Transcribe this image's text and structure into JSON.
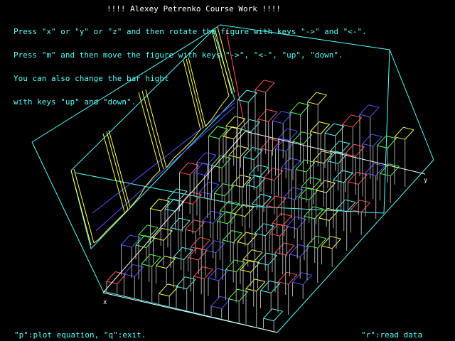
{
  "window": {
    "title": "!!!! Alexey Petrenko Course Work !!!!"
  },
  "instructions": [
    "Press \"x\" or \"y\" or \"z\" and then rotate the figure with keys \"->\" and \"<-\".",
    "Press \"m\" and then move the figure with keys \"->\", \"<-\", \"up\", \"down\".",
    "You can also change the bar hight",
    "with keys \"up\" and \"down\"."
  ],
  "footer": {
    "left": "\"p\":plot equation, \"q\":exit.",
    "right": "\"r\":read data"
  },
  "axes": {
    "x_label": "x",
    "y_label": "y"
  },
  "colors": {
    "background": "#000000",
    "text_title": "#ffffff",
    "text_info": "#55ffff",
    "box_edges": "#55ffff",
    "equation_plot": "#ffff55",
    "plane_line": "#5555ff",
    "bar_edges": "#aaaaaa",
    "bar_top_red": "#ff5555",
    "bar_top_blue": "#5555ff",
    "bar_top_green": "#55ff55",
    "bar_top_yellow": "#ffff55",
    "axis": "#ffffff",
    "accent_red": "#ff5555"
  }
}
